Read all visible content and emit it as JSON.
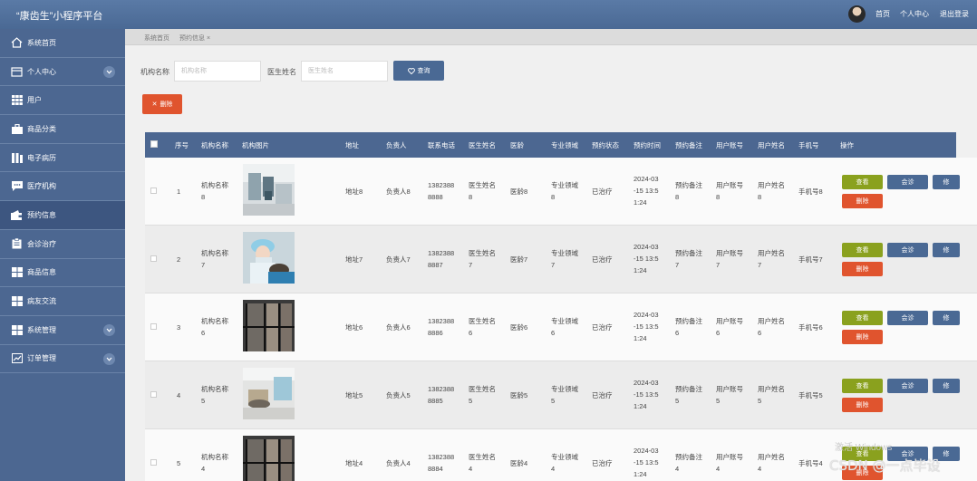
{
  "header": {
    "title": "“康齿生”小程序平台",
    "nav": [
      "首页",
      "个人中心",
      "退出登录"
    ]
  },
  "sidebar": {
    "items": [
      {
        "label": "系统首页",
        "icon": "home-icon",
        "expand": false
      },
      {
        "label": "个人中心",
        "icon": "window-icon",
        "expand": true
      },
      {
        "label": "用户",
        "icon": "grid-icon",
        "expand": false
      },
      {
        "label": "商品分类",
        "icon": "briefcase-icon",
        "expand": false
      },
      {
        "label": "电子病历",
        "icon": "columns-icon",
        "expand": false
      },
      {
        "label": "医疗机构",
        "icon": "chat-icon",
        "expand": false
      },
      {
        "label": "预约信息",
        "icon": "wallet-icon",
        "expand": false,
        "active": true
      },
      {
        "label": "会诊治疗",
        "icon": "clipboard-icon",
        "expand": false
      },
      {
        "label": "商品信息",
        "icon": "tiles-icon",
        "expand": false
      },
      {
        "label": "病友交流",
        "icon": "tiles-icon",
        "expand": false
      },
      {
        "label": "系统管理",
        "icon": "tiles-icon",
        "expand": true
      },
      {
        "label": "订单管理",
        "icon": "chart-icon",
        "expand": true
      }
    ]
  },
  "breadcrumb": [
    "系统首页",
    "预约信息 ×"
  ],
  "search": {
    "org_label": "机构名称",
    "org_placeholder": "机构名称",
    "doctor_label": "医生姓名",
    "doctor_placeholder": "医生姓名",
    "query_label": "查询"
  },
  "actions": {
    "delete_label": "删除"
  },
  "table": {
    "columns": [
      "序号",
      "机构名称",
      "机构图片",
      "地址",
      "负责人",
      "联系电话",
      "医生姓名",
      "医龄",
      "专业领域",
      "预约状态",
      "预约时间",
      "预约备注",
      "用户账号",
      "用户姓名",
      "手机号",
      "操作"
    ],
    "buttons": {
      "view": "查看",
      "consult": "会诊",
      "edit": "修",
      "delete": "删除"
    },
    "rows": [
      {
        "idx": "1",
        "org": [
          "机构名称",
          "8"
        ],
        "addr": "地址8",
        "owner": "负责人8",
        "phone": [
          "1382388",
          "8888"
        ],
        "doctor": [
          "医生姓名",
          "8"
        ],
        "age": "医龄8",
        "field": [
          "专业领域",
          "8"
        ],
        "status": "已治疗",
        "time": [
          "2024-03",
          "-15 13:5",
          "1:24"
        ],
        "note": [
          "预约备注",
          "8"
        ],
        "account": [
          "用户账号",
          "8"
        ],
        "uname": [
          "用户姓名",
          "8"
        ],
        "mobile": "手机号8",
        "photo": "clinic-room"
      },
      {
        "idx": "2",
        "org": [
          "机构名称",
          "7"
        ],
        "addr": "地址7",
        "owner": "负责人7",
        "phone": [
          "1382388",
          "8887"
        ],
        "doctor": [
          "医生姓名",
          "7"
        ],
        "age": "医龄7",
        "field": [
          "专业领域",
          "7"
        ],
        "status": "已治疗",
        "time": [
          "2024-03",
          "-15 13:5",
          "1:24"
        ],
        "note": [
          "预约备注",
          "7"
        ],
        "account": [
          "用户账号",
          "7"
        ],
        "uname": [
          "用户姓名",
          "7"
        ],
        "mobile": "手机号7",
        "photo": "dentist"
      },
      {
        "idx": "3",
        "org": [
          "机构名称",
          "6"
        ],
        "addr": "地址6",
        "owner": "负责人6",
        "phone": [
          "1382388",
          "8886"
        ],
        "doctor": [
          "医生姓名",
          "6"
        ],
        "age": "医龄6",
        "field": [
          "专业领域",
          "6"
        ],
        "status": "已治疗",
        "time": [
          "2024-03",
          "-15 13:5",
          "1:24"
        ],
        "note": [
          "预约备注",
          "6"
        ],
        "account": [
          "用户账号",
          "6"
        ],
        "uname": [
          "用户姓名",
          "6"
        ],
        "mobile": "手机号6",
        "photo": "glass-door"
      },
      {
        "idx": "4",
        "org": [
          "机构名称",
          "5"
        ],
        "addr": "地址5",
        "owner": "负责人5",
        "phone": [
          "1382388",
          "8885"
        ],
        "doctor": [
          "医生姓名",
          "5"
        ],
        "age": "医龄5",
        "field": [
          "专业领域",
          "5"
        ],
        "status": "已治疗",
        "time": [
          "2024-03",
          "-15 13:5",
          "1:24"
        ],
        "note": [
          "预约备注",
          "5"
        ],
        "account": [
          "用户账号",
          "5"
        ],
        "uname": [
          "用户姓名",
          "5"
        ],
        "mobile": "手机号5",
        "photo": "treatment-room"
      },
      {
        "idx": "5",
        "org": [
          "机构名称",
          "4"
        ],
        "addr": "地址4",
        "owner": "负责人4",
        "phone": [
          "1382388",
          "8884"
        ],
        "doctor": [
          "医生姓名",
          "4"
        ],
        "age": "医龄4",
        "field": [
          "专业领域",
          "4"
        ],
        "status": "已治疗",
        "time": [
          "2024-03",
          "-15 13:5",
          "1:24"
        ],
        "note": [
          "预约备注",
          "4"
        ],
        "account": [
          "用户账号",
          "4"
        ],
        "uname": [
          "用户姓名",
          "4"
        ],
        "mobile": "手机号4",
        "photo": "glass-door"
      }
    ]
  },
  "watermarks": {
    "windows": "激活 Windows",
    "csdn": "CSDN @一点毕设"
  },
  "colors": {
    "header": "#4a6994",
    "sidebar": "#4c6791",
    "view_button": "#8aa11e",
    "delete_button": "#e0542e"
  }
}
